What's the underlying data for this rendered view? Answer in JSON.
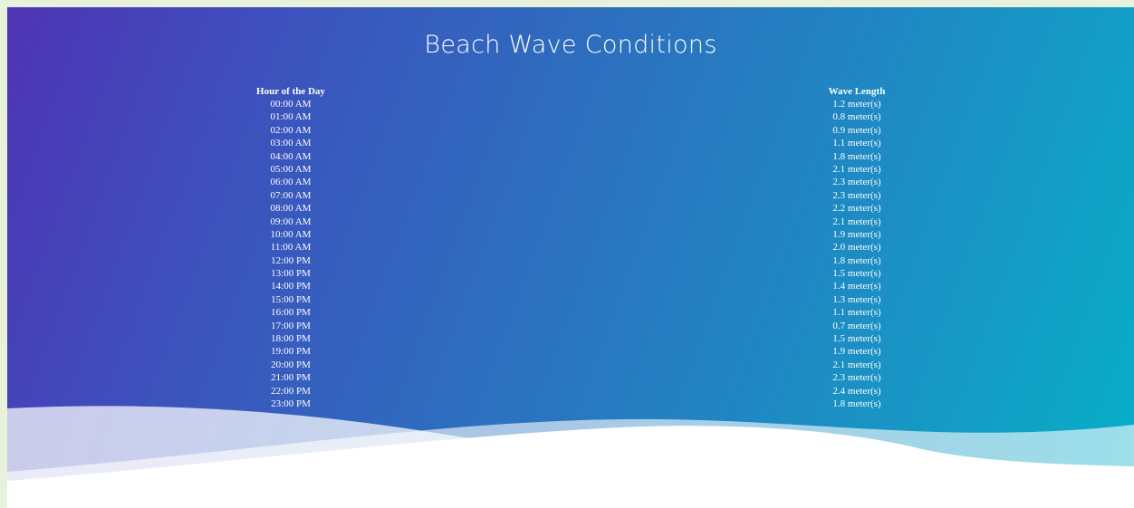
{
  "page": {
    "title": "Beach Wave Conditions"
  },
  "table": {
    "columns": [
      "Hour of the Day",
      "Wave Length"
    ],
    "hours": [
      "00:00 AM",
      "01:00 AM",
      "02:00 AM",
      "03:00 AM",
      "04:00 AM",
      "05:00 AM",
      "06:00 AM",
      "07:00 AM",
      "08:00 AM",
      "09:00 AM",
      "10:00 AM",
      "11:00 AM",
      "12:00 PM",
      "13:00 PM",
      "14:00 PM",
      "15:00 PM",
      "16:00 PM",
      "17:00 PM",
      "18:00 PM",
      "19:00 PM",
      "20:00 PM",
      "21:00 PM",
      "22:00 PM",
      "23:00 PM"
    ],
    "wave_lengths": [
      "1.2 meter(s)",
      "0.8 meter(s)",
      "0.9 meter(s)",
      "1.1 meter(s)",
      "1.8 meter(s)",
      "2.1 meter(s)",
      "2.3 meter(s)",
      "2.3 meter(s)",
      "2.2 meter(s)",
      "2.1 meter(s)",
      "1.9 meter(s)",
      "2.0 meter(s)",
      "1.8 meter(s)",
      "1.5 meter(s)",
      "1.4 meter(s)",
      "1.3 meter(s)",
      "1.1 meter(s)",
      "0.7 meter(s)",
      "1.5 meter(s)",
      "1.9 meter(s)",
      "2.1 meter(s)",
      "2.3 meter(s)",
      "2.4 meter(s)",
      "1.8 meter(s)"
    ]
  },
  "colors": {
    "gradient_start": "#4f34b6",
    "gradient_end": "#07b0c8",
    "text": "#ffffff",
    "wave_fill": "#ffffff"
  }
}
